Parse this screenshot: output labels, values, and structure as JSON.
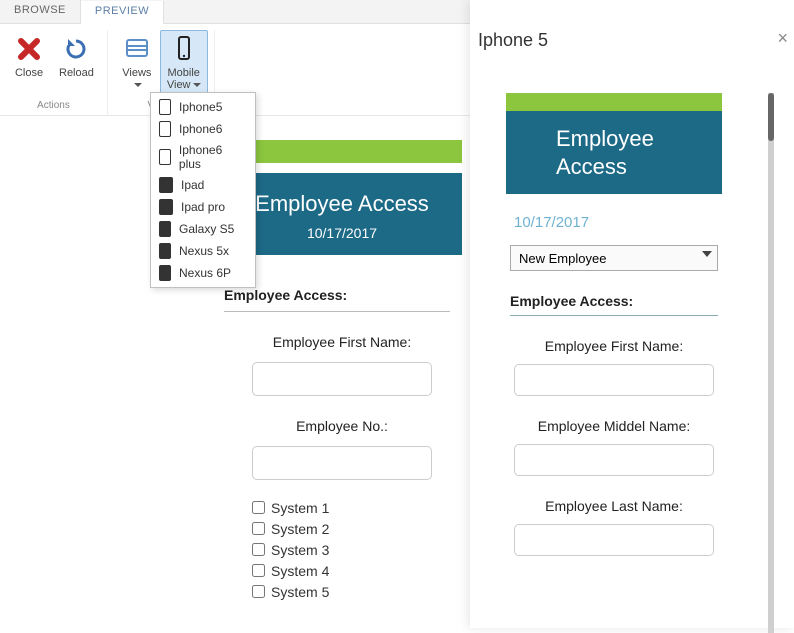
{
  "tabs": {
    "browse": "BROWSE",
    "preview": "PREVIEW"
  },
  "ribbon": {
    "close": "Close",
    "reload": "Reload",
    "views": "Views",
    "mobile_view": "Mobile\nView",
    "group_actions": "Actions",
    "group_views": "Views"
  },
  "devices": [
    {
      "label": "Iphone5",
      "kind": "phone-outline"
    },
    {
      "label": "Iphone6",
      "kind": "phone-outline"
    },
    {
      "label": "Iphone6 plus",
      "kind": "phone-outline"
    },
    {
      "label": "Ipad",
      "kind": "tablet-filled"
    },
    {
      "label": "Ipad pro",
      "kind": "tablet-filled"
    },
    {
      "label": "Galaxy S5",
      "kind": "phone-filled"
    },
    {
      "label": "Nexus 5x",
      "kind": "phone-filled"
    },
    {
      "label": "Nexus 6P",
      "kind": "phone-filled"
    }
  ],
  "form": {
    "title": "Employee Access",
    "date": "10/17/2017",
    "section": "Employee Access:",
    "emp_first": "Employee First Name:",
    "emp_no": "Employee No.:",
    "systems": [
      "System 1",
      "System 2",
      "System 3",
      "System 4",
      "System 5"
    ]
  },
  "phone": {
    "device_title": "Iphone 5",
    "header_l1": "Employee",
    "header_l2": "Access",
    "date": "10/17/2017",
    "select_value": "New Employee",
    "section": "Employee Access:",
    "first": "Employee First Name:",
    "middle": "Employee Middel Name:",
    "last": "Employee Last Name:"
  }
}
